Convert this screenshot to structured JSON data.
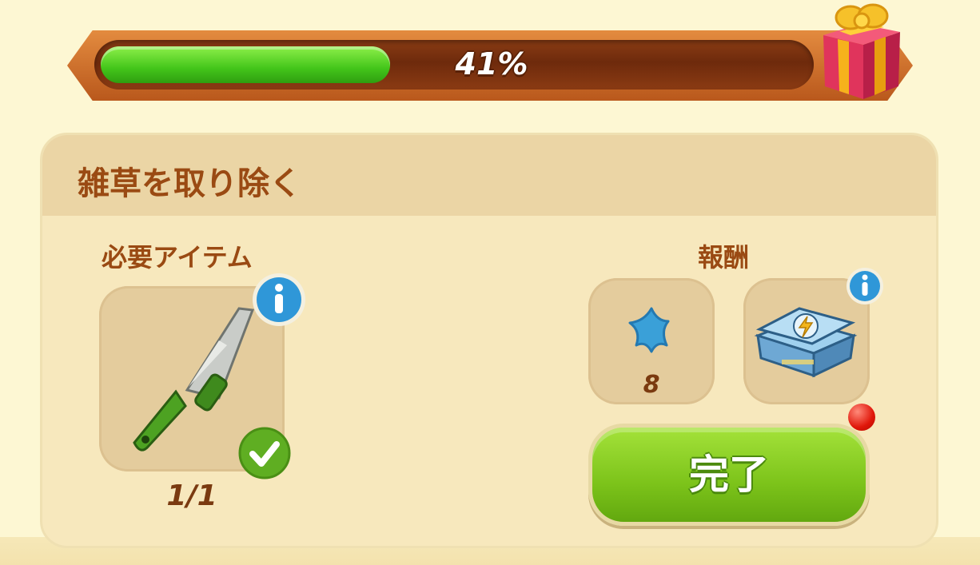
{
  "progress": {
    "percent": 41,
    "label": "41%"
  },
  "task": {
    "title": "雑草を取り除く",
    "required_label": "必要アイテム",
    "reward_label": "報酬"
  },
  "required_item": {
    "icon": "knife-icon",
    "count": "1/1",
    "completed": true
  },
  "rewards": [
    {
      "icon": "blue-star-icon",
      "count": "8"
    },
    {
      "icon": "energy-chest-icon",
      "count": ""
    }
  ],
  "complete_button": {
    "label": "完了"
  },
  "colors": {
    "accent_text": "#9a4a13",
    "progress_fill": "#43c51a",
    "button_green": "#7cc31a"
  }
}
